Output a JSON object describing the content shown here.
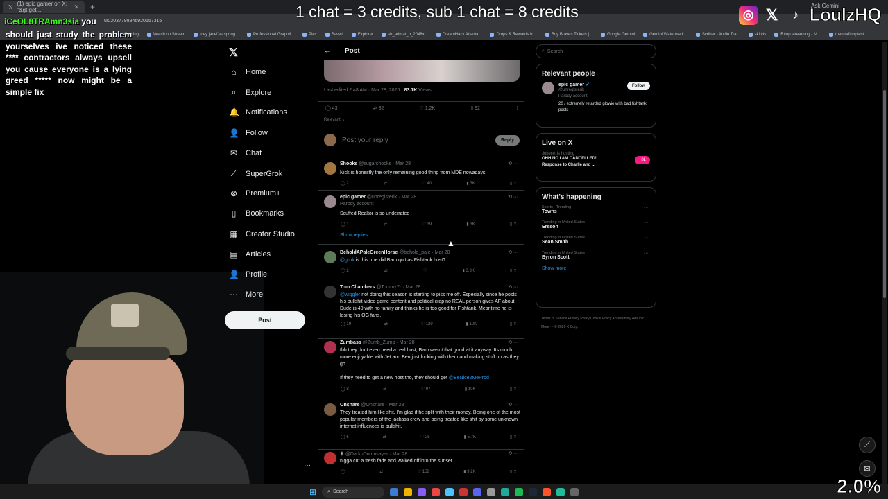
{
  "browser": {
    "tab_title": "(1) epic gamer on X: \"&gt;get...",
    "url_fragment": "us/2037798946920157315",
    "ask_gemini": "Ask Gemini",
    "bookmarks": [
      "Gaming",
      "Watch on Stream",
      "joey janel'as spring...",
      "Professional Grappli...",
      "Plex",
      "Saved",
      "Explorer",
      "sh_admat_b_2048x...",
      "DreamHack Atlanta...",
      "Drops & Rewards in...",
      "Buy Braves Tickets |...",
      "Google Gemini",
      "Gemini Watermark...",
      "Scriber - Audio Tra...",
      "skipits",
      "Rtmp streaming - M...",
      "mentraftimptest"
    ]
  },
  "overlay": {
    "banner": "1 chat = 3 credits, sub 1 chat = 8 credits",
    "brand": "LoulzHQ",
    "chat_username": "iCeOL8TRAmn3sia",
    "chat_username_suffix": "you",
    "chat_message": "should just study the problem yourselves ive noticed these **** contractors always upsell you cause everyone is a lying greed ***** now might be a simple fix",
    "zoom_percent": "2.0%"
  },
  "nav": {
    "items": [
      {
        "label": "Home",
        "icon": "home-icon"
      },
      {
        "label": "Explore",
        "icon": "search-icon"
      },
      {
        "label": "Notifications",
        "icon": "bell-icon"
      },
      {
        "label": "Follow",
        "icon": "person-plus-icon"
      },
      {
        "label": "Chat",
        "icon": "chat-icon"
      },
      {
        "label": "SuperGrok",
        "icon": "grok-icon"
      },
      {
        "label": "Premium+",
        "icon": "x-circle-icon"
      },
      {
        "label": "Bookmarks",
        "icon": "bookmark-icon"
      },
      {
        "label": "Creator Studio",
        "icon": "studio-icon"
      },
      {
        "label": "Articles",
        "icon": "article-icon"
      },
      {
        "label": "Profile",
        "icon": "person-icon"
      },
      {
        "label": "More",
        "icon": "more-icon"
      }
    ],
    "post_button": "Post"
  },
  "post": {
    "header": "Post",
    "edited": "Last edited 2:48 AM · Mar 28, 2026 ·",
    "views_count": "83.1K",
    "views_label": "Views",
    "stats": {
      "replies": "43",
      "reposts": "32",
      "likes": "1.2K",
      "bookmarks": "92"
    },
    "sort": "Relevant",
    "reply_placeholder": "Post your reply",
    "reply_button": "Reply"
  },
  "replies": [
    {
      "name": "Shooks",
      "handle": "@sugarshooks",
      "date": "Mar 28",
      "text": "Nick is honestly the only remaining good thing from MDE nowadays.",
      "replies": "2",
      "reposts": "",
      "likes": "40",
      "views": "3K",
      "color": "#a07840"
    },
    {
      "name": "epic gamer",
      "handle": "@unreglsterik",
      "date": "Mar 28",
      "sub": "Parody account",
      "text": "Scuffed Realtor is so underrated",
      "replies": "1",
      "reposts": "",
      "likes": "39",
      "views": "3K",
      "color": "#9a8a8f",
      "show_replies": "Show replies"
    },
    {
      "name": "BeholdAPaleGreenHorse",
      "handle": "@behold_pale",
      "date": "Mar 28",
      "mention": "@grok",
      "text": " is this true did Bam quit as Fishtank host?",
      "replies": "2",
      "reposts": "",
      "likes": "",
      "views": "3.3K",
      "color": "#5f7a5a"
    },
    {
      "name": "Tom Chambers",
      "handle": "@Tommz7r",
      "date": "Mar 28",
      "mention": "@wiggler",
      "text": " not doing this season is starting to piss me off. Especially since he posts his bullshit video game content and political crap no REAL person gives AF about. Dude is 40 with no family and thinks he is too good for Fishtank. Meantime he is losing his OG fans.",
      "replies": "19",
      "reposts": "",
      "likes": "129",
      "views": "10K",
      "color": "#333"
    },
    {
      "name": "Zumbass",
      "handle": "@Zumb_Zumb",
      "date": "Mar 28",
      "text": "tbh they dont even need a real host, Bam wasnt that good at it anyway. Its much more enjoyable with Jet and Ben just fucking with them and making stuff up as they go",
      "text2": "If they need to get a new host tho, they should get ",
      "mention2": "@BeNice2MeProd",
      "replies": "8",
      "reposts": "",
      "likes": "97",
      "views": "10K",
      "color": "#b03050"
    },
    {
      "name": "Onsnare",
      "handle": "@Onsnare",
      "date": "Mar 28",
      "text": "They treated him like shit. I'm glad if he split with their money. Being one of the most popular members of the jackass crew and being treated like shit by some unknown internet influences is bullshit.",
      "replies": "6",
      "reposts": "",
      "likes": "25",
      "views": "5.7K",
      "color": "#7a5a40"
    },
    {
      "name": "✝",
      "handle": "@DarkoDoomsayer",
      "date": "Mar 28",
      "text": "nigga cut a fresh fade and walked off into the sunset.",
      "replies": "",
      "reposts": "",
      "likes": "158",
      "views": "9.2K",
      "color": "#c03030"
    }
  ],
  "sidebar": {
    "search_placeholder": "Search",
    "relevant_title": "Relevant people",
    "person_name": "epic gamer",
    "person_handle": "@unreglsterik",
    "person_sub": "Parody account",
    "person_bio": "20 / extremely retarded glowie with bad fishtank posts",
    "follow_button": "Follow",
    "live_title": "Live on X",
    "live_host": "Joker☠ is hosting",
    "live_line1": "OHH NO I AM CANCELLED!",
    "live_line2": "Response to Charlie and ...",
    "live_count": "+81",
    "happening_title": "What's happening",
    "trends": [
      {
        "context": "Sports · Trending",
        "name": "Towns"
      },
      {
        "context": "Trending in United States",
        "name": "Ersson"
      },
      {
        "context": "Trending in United States",
        "name": "Sean Smith"
      },
      {
        "context": "Trending in United States",
        "name": "Byron Scott"
      }
    ],
    "show_more": "Show more",
    "footer": "Terms of Service   Privacy Policy   Cookie Policy   Accessibility   Ads info   More ···   © 2026 X Corp."
  },
  "taskbar": {
    "search_label": "Search"
  },
  "colors": {
    "accent": "#1d9bf0",
    "chat_name": "#39ff14",
    "live": "#f91880"
  }
}
